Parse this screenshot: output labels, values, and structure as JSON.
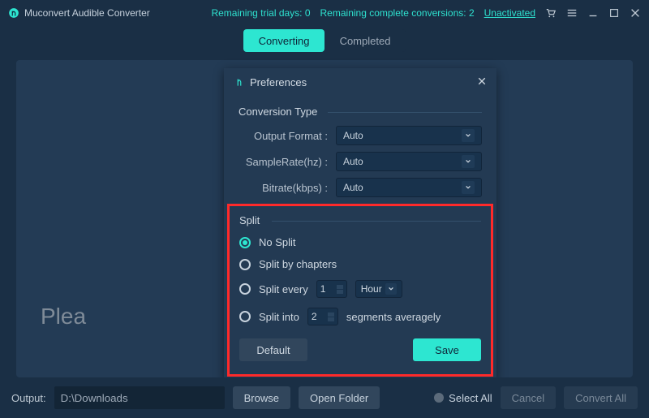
{
  "titlebar": {
    "appName": "Muconvert Audible Converter",
    "trialDaysLabel": "Remaining trial days: 0",
    "completeConvLabel": "Remaining complete conversions: 2",
    "unactivated": "Unactivated"
  },
  "tabs": {
    "converting": "Converting",
    "completed": "Completed"
  },
  "main": {
    "placeholder": "Plea"
  },
  "modal": {
    "title": "Preferences",
    "conversionType": {
      "heading": "Conversion Type",
      "outputFormatLabel": "Output Format :",
      "outputFormatValue": "Auto",
      "sampleRateLabel": "SampleRate(hz) :",
      "sampleRateValue": "Auto",
      "bitrateLabel": "Bitrate(kbps) :",
      "bitrateValue": "Auto"
    },
    "split": {
      "heading": "Split",
      "noSplit": "No Split",
      "byChapters": "Split by chapters",
      "everyLabel": "Split every",
      "everyValue": "1",
      "everyUnit": "Hour",
      "intoLabel": "Split into",
      "intoValue": "2",
      "intoSuffix": "segments averagely"
    },
    "buttons": {
      "default": "Default",
      "save": "Save"
    }
  },
  "bottombar": {
    "outputLabel": "Output:",
    "outputPath": "D:\\Downloads",
    "browse": "Browse",
    "openFolder": "Open Folder",
    "selectAll": "Select All",
    "cancel": "Cancel",
    "convertAll": "Convert All"
  }
}
